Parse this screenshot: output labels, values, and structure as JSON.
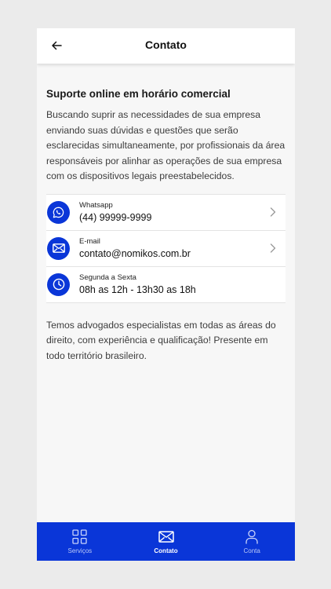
{
  "header": {
    "title": "Contato",
    "back_icon": "arrow-left-icon"
  },
  "main": {
    "title": "Suporte online em horário comercial",
    "description": "Buscando suprir as necessidades de sua empresa enviando suas dúvidas e questões que serão esclarecidas simultaneamente, por profissionais da área responsáveis por alinhar as operações de sua empresa com os dispositivos legais preestabelecidos.",
    "contacts": [
      {
        "icon": "whatsapp-icon",
        "label": "Whatsapp",
        "value": "(44) 99999-9999",
        "has_chevron": true
      },
      {
        "icon": "mail-icon",
        "label": "E-mail",
        "value": "contato@nomikos.com.br",
        "has_chevron": true
      },
      {
        "icon": "clock-icon",
        "label": "Segunda a Sexta",
        "value": "08h as 12h - 13h30 as 18h",
        "has_chevron": false
      }
    ],
    "footer_text": "Temos advogados especialistas em todas as áreas do direito, com experiência e qualificação! Presente em todo território brasileiro."
  },
  "bottom_nav": {
    "items": [
      {
        "label": "Serviços",
        "icon": "grid-icon",
        "active": false
      },
      {
        "label": "Contato",
        "icon": "mail-icon",
        "active": true
      },
      {
        "label": "Conta",
        "icon": "user-icon",
        "active": false
      }
    ]
  },
  "colors": {
    "accent": "#0a36d8",
    "background": "#f7f7f7",
    "header_bg": "#ffffff"
  }
}
